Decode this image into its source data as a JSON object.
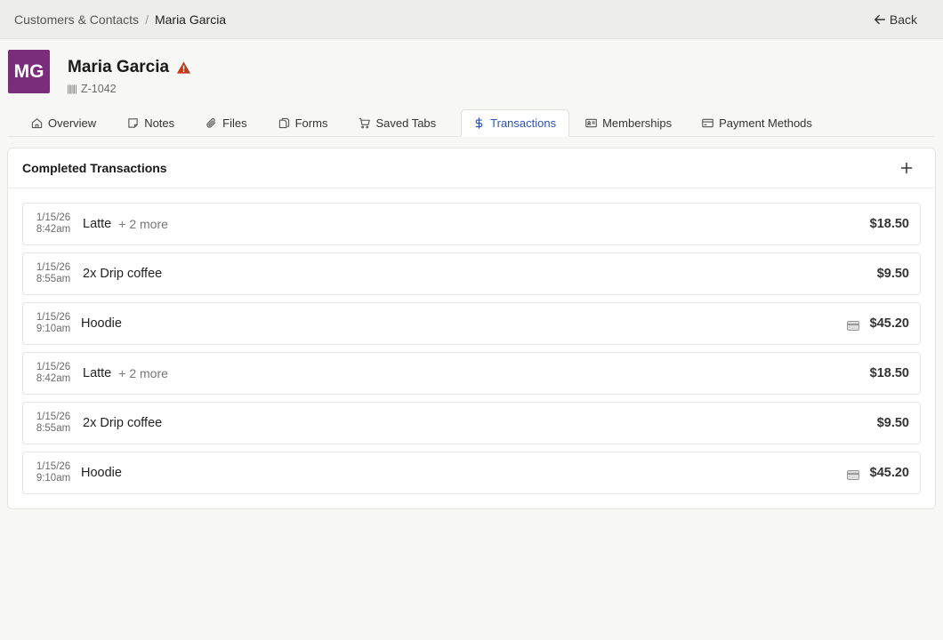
{
  "breadcrumb": {
    "parent": "Customers & Contacts",
    "separator": "/",
    "current": "Maria Garcia"
  },
  "back_label": "Back",
  "customer": {
    "initials": "MG",
    "name": "Maria Garcia",
    "id": "Z-1042",
    "avatar_color": "#7a2d7a",
    "warning_color": "#c0391b"
  },
  "tabs": [
    {
      "label": "Overview",
      "icon": "home-icon"
    },
    {
      "label": "Notes",
      "icon": "note-icon"
    },
    {
      "label": "Files",
      "icon": "paperclip-icon"
    },
    {
      "label": "Forms",
      "icon": "copy-icon"
    },
    {
      "label": "Saved Tabs",
      "icon": "cart-icon"
    },
    {
      "label": "Transactions",
      "icon": "dollar-icon",
      "active": true
    },
    {
      "label": "Memberships",
      "icon": "id-card-icon"
    },
    {
      "label": "Payment Methods",
      "icon": "credit-card-icon"
    }
  ],
  "panel": {
    "title": "Completed Transactions"
  },
  "transactions": [
    {
      "date": "1/15/26",
      "time": "8:42am",
      "item": "Latte",
      "more": "+ 2 more",
      "amount": "$18.50",
      "card": false
    },
    {
      "date": "1/15/26",
      "time": "8:55am",
      "item": "2x Drip coffee",
      "more": "",
      "amount": "$9.50",
      "card": false
    },
    {
      "date": "1/15/26",
      "time": "9:10am",
      "item": "Hoodie",
      "more": "",
      "amount": "$45.20",
      "card": true
    },
    {
      "date": "1/15/26",
      "time": "8:42am",
      "item": "Latte",
      "more": "+ 2 more",
      "amount": "$18.50",
      "card": false
    },
    {
      "date": "1/15/26",
      "time": "8:55am",
      "item": "2x Drip coffee",
      "more": "",
      "amount": "$9.50",
      "card": false
    },
    {
      "date": "1/15/26",
      "time": "9:10am",
      "item": "Hoodie",
      "more": "",
      "amount": "$45.20",
      "card": true
    }
  ]
}
